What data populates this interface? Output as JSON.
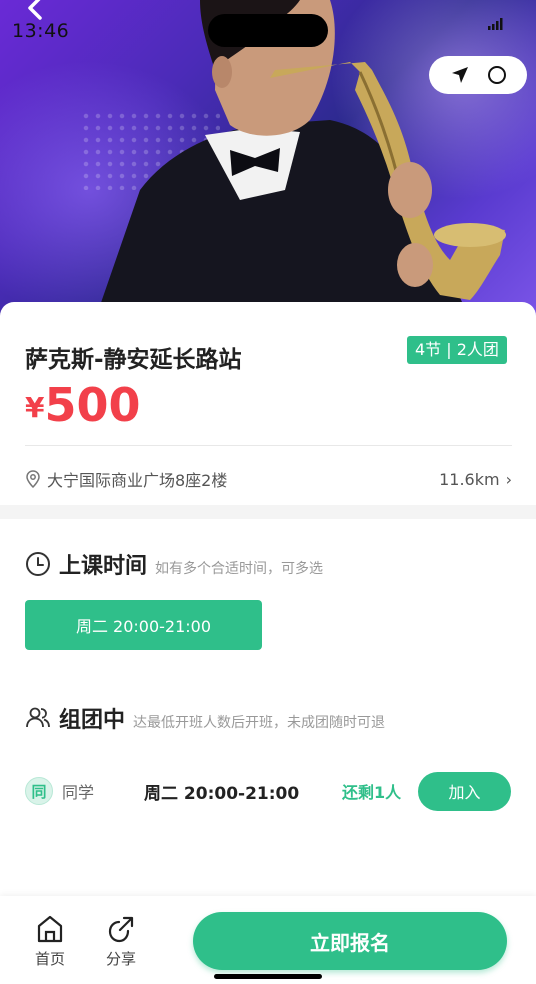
{
  "status_bar": {
    "time": "13:46"
  },
  "course": {
    "title": "萨克斯-静安延长路站",
    "tag": "4节 | 2人团",
    "price_symbol": "¥",
    "price": "500",
    "address": "大宁国际商业广场8座2楼",
    "distance": "11.6km",
    "distance_chevron": "›"
  },
  "schedule": {
    "heading": "上课时间",
    "hint": "如有多个合适时间，可多选",
    "options": [
      {
        "label": "周二 20:00-21:00"
      }
    ]
  },
  "group": {
    "heading": "组团中",
    "hint": "达最低开班人数后开班，未成团随时可退",
    "rows": [
      {
        "avatar": "同",
        "member": "同学",
        "time": "周二 20:00-21:00",
        "remaining": "还剩1人",
        "join_label": "加入"
      }
    ]
  },
  "bottom_bar": {
    "home_label": "首页",
    "share_label": "分享",
    "signup_label": "立即报名"
  },
  "colors": {
    "accent": "#2fbf8a",
    "price": "#f2404a"
  },
  "icons": [
    "back-icon",
    "signal-icon",
    "send-icon",
    "circle-icon",
    "location-pin-icon",
    "clock-icon",
    "people-icon",
    "home-icon",
    "share-icon"
  ]
}
